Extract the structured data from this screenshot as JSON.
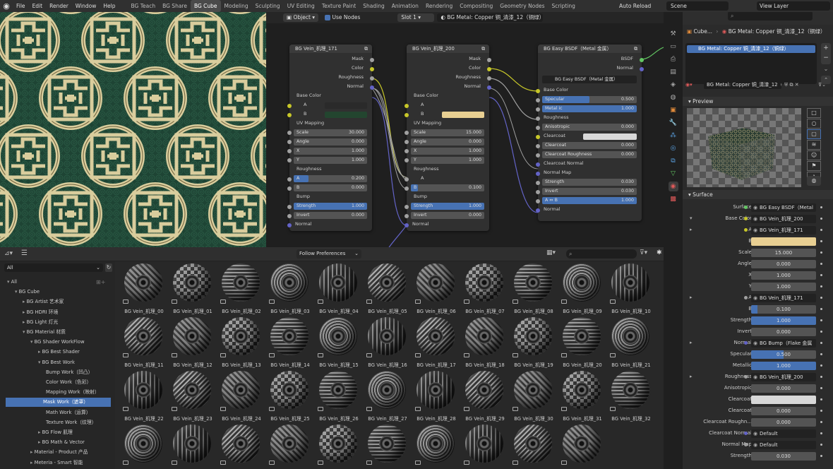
{
  "menu": [
    "File",
    "Edit",
    "Render",
    "Window",
    "Help"
  ],
  "workspaces": [
    "BG Teach",
    "BG Share",
    "BG Cube",
    "Modeling",
    "Sculpting",
    "UV Editing",
    "Texture Paint",
    "Shading",
    "Animation",
    "Rendering",
    "Compositing",
    "Geometry Nodes",
    "Scripting"
  ],
  "active_workspace": "BG Cube",
  "auto_reload": "Auto Reload",
  "scene": "Scene",
  "view_layer": "View Layer",
  "node_header": {
    "object": "Object",
    "use_nodes": "Use Nodes",
    "slot": "Slot 1",
    "material": "BG Metal: Copper 铜_清漆_12（铜绿）"
  },
  "nodes": {
    "vein171": {
      "title": "BG Vein_机理_171",
      "outputs": [
        "Mask",
        "Color",
        "Roughness",
        "Normal"
      ],
      "base_color": "Base Color",
      "a": "A",
      "b": "B",
      "uv_mapping": "UV Mapping",
      "scale_l": "Scale",
      "scale": "30.000",
      "angle_l": "Angle",
      "angle": "0.000",
      "x_l": "X",
      "x": "1.000",
      "y_l": "Y",
      "y": "1.000",
      "roughness": "Roughness",
      "ra": "0.200",
      "rb": "0.000",
      "bump": "Bump",
      "strength_l": "Strength",
      "strength": "1.000",
      "invert_l": "Invert",
      "invert": "0.000",
      "normal": "Normal"
    },
    "vein200": {
      "title": "BG Vein_机理_200",
      "outputs": [
        "Mask",
        "Color",
        "Roughness",
        "Normal"
      ],
      "base_color": "Base Color",
      "a": "A",
      "b": "B",
      "uv_mapping": "UV Mapping",
      "scale_l": "Scale",
      "scale": "15.000",
      "angle_l": "Angle",
      "angle": "0.000",
      "x_l": "X",
      "x": "1.000",
      "y_l": "Y",
      "y": "1.000",
      "roughness": "Roughness",
      "ra": "A",
      "rb": "0.100",
      "bump": "Bump",
      "strength_l": "Strength",
      "strength": "1.000",
      "invert_l": "Invert",
      "invert": "0.000",
      "normal": "Normal"
    },
    "bsdf": {
      "title": "BG Easy BSDF（Metal 金属）",
      "outputs": [
        "BSDF",
        "Normal"
      ],
      "group": "BG Easy BSDF（Metal 金属）",
      "base_color": "Base Color",
      "specular_l": "Specular",
      "specular": "0.500",
      "metal_l": "Metal ic",
      "metal": "1.000",
      "roughness": "Roughness",
      "aniso_l": "Anisotropic",
      "aniso": "0.000",
      "clearcoat": "Clearcoat",
      "cc_l": "Clearcoat",
      "cc": "0.000",
      "ccr_l": "Clearcoat Roughness",
      "ccr": "0.000",
      "ccn": "Clearcoat Normal",
      "nmap": "Normal Map",
      "strength_l": "Strength",
      "strength": "0.030",
      "invert_l": "Invert",
      "invert": "0.030",
      "ab_l": "A ⇔ B",
      "ab": "1.000",
      "normal": "Normal"
    }
  },
  "browser": {
    "filter": "Follow Preferences",
    "library": "All",
    "tree": [
      {
        "label": "All",
        "depth": 0,
        "arrow": "▾"
      },
      {
        "label": "BG Cube",
        "depth": 1,
        "arrow": "▾"
      },
      {
        "label": "BG Artist 艺术家",
        "depth": 2,
        "arrow": "▸"
      },
      {
        "label": "BG HDRI 环境",
        "depth": 2,
        "arrow": "▸"
      },
      {
        "label": "BG Light 灯光",
        "depth": 2,
        "arrow": "▸"
      },
      {
        "label": "BG Material 材质",
        "depth": 2,
        "arrow": "▾"
      },
      {
        "label": "BG Shader WorkFlow",
        "depth": 3,
        "arrow": "▾"
      },
      {
        "label": "BG Best Shader",
        "depth": 4,
        "arrow": "▸"
      },
      {
        "label": "BG Best Work",
        "depth": 4,
        "arrow": "▾"
      },
      {
        "label": "Bump Work（凹凸）",
        "depth": 5,
        "arrow": ""
      },
      {
        "label": "Color Work（色彩）",
        "depth": 5,
        "arrow": ""
      },
      {
        "label": "Mapping Work（映射）",
        "depth": 5,
        "arrow": ""
      },
      {
        "label": "Mask Work（遮罩）",
        "depth": 5,
        "arrow": "",
        "selected": true
      },
      {
        "label": "Math Work（运算）",
        "depth": 5,
        "arrow": ""
      },
      {
        "label": "Texture Work（纹理）",
        "depth": 5,
        "arrow": ""
      },
      {
        "label": "BG Flow 肌理",
        "depth": 4,
        "arrow": "▸"
      },
      {
        "label": "BG Math & Vector",
        "depth": 4,
        "arrow": "▸"
      },
      {
        "label": "Material - Product 产品",
        "depth": 3,
        "arrow": "▸"
      },
      {
        "label": "Meteria - Smart 智能",
        "depth": 3,
        "arrow": "▸"
      }
    ],
    "assets": [
      "BG Vein_机理_00",
      "BG Vein_机理_01",
      "BG Vein_机理_02",
      "BG Vein_机理_03",
      "BG Vein_机理_04",
      "BG Vein_机理_05",
      "BG Vein_机理_06",
      "BG Vein_机理_07",
      "BG Vein_机理_08",
      "BG Vein_机理_09",
      "BG Vein_机理_10",
      "BG Vein_机理_11",
      "BG Vein_机理_12",
      "BG Vein_机理_13",
      "BG Vein_机理_14",
      "BG Vein_机理_15",
      "BG Vein_机理_16",
      "BG Vein_机理_17",
      "BG Vein_机理_18",
      "BG Vein_机理_19",
      "BG Vein_机理_20",
      "BG Vein_机理_21",
      "BG Vein_机理_22",
      "BG Vein_机理_23",
      "BG Vein_机理_24",
      "BG Vein_机理_25",
      "BG Vein_机理_26",
      "BG Vein_机理_27",
      "BG Vein_机理_28",
      "BG Vein_机理_29",
      "BG Vein_机理_30",
      "BG Vein_机理_31",
      "BG Vein_机理_32",
      "",
      "",
      "",
      "",
      "",
      "",
      "",
      "",
      "",
      ""
    ]
  },
  "props": {
    "breadcrumb": [
      "Cube...",
      "BG Metal: Copper 铜_清漆_12（铜绿）"
    ],
    "slot_item": "BG Metal: Copper 铜_清漆_12（铜绿）",
    "material_name": "BG Metal: Copper 铜_清漆_12（...",
    "preview": "Preview",
    "surface": "Surface",
    "rows": [
      {
        "label": "Surface",
        "value": "BG Easy BSDF（Metal 金...",
        "kind": "link",
        "sock": "#63c763"
      },
      {
        "label": "Base Color",
        "value": "BG Vein_机理_200",
        "kind": "link",
        "sock": "#c7c729",
        "arrow": "▾"
      },
      {
        "label": "A",
        "value": "BG Vein_机理_171",
        "kind": "link",
        "sock": "#c7c729",
        "arrow": "▸"
      },
      {
        "label": "B",
        "value": "",
        "kind": "color",
        "color": "#e8cf92"
      },
      {
        "label": "Scale",
        "value": "15.000",
        "kind": "num"
      },
      {
        "label": "Angle",
        "value": "0.000",
        "kind": "num"
      },
      {
        "label": "X",
        "value": "1.000",
        "kind": "num"
      },
      {
        "label": "Y",
        "value": "1.000",
        "kind": "num"
      },
      {
        "label": "A",
        "value": "BG Vein_机理_171",
        "kind": "link",
        "sock": "#a1a1a1",
        "arrow": "▸"
      },
      {
        "label": "B",
        "value": "0.100",
        "kind": "bar",
        "fill": 0.1
      },
      {
        "label": "Strength",
        "value": "1.000",
        "kind": "bar",
        "fill": 1
      },
      {
        "label": "Invert",
        "value": "0.000",
        "kind": "num"
      },
      {
        "label": "Normal",
        "value": "BG Bump（Flake 金属亮片...",
        "kind": "link",
        "sock": "#6363c7",
        "arrow": "▸"
      },
      {
        "label": "Specular",
        "value": "0.500",
        "kind": "bar",
        "fill": 0.5
      },
      {
        "label": "Metallic",
        "value": "1.000",
        "kind": "bar",
        "fill": 1
      },
      {
        "label": "Roughness",
        "value": "BG Vein_机理_200",
        "kind": "link",
        "sock": "#a1a1a1",
        "arrow": "▸"
      },
      {
        "label": "Anisotropic",
        "value": "0.000",
        "kind": "num"
      },
      {
        "label": "Clearcoat",
        "value": "",
        "kind": "color",
        "color": "#d8d8d8"
      },
      {
        "label": "Clearcoat",
        "value": "0.000",
        "kind": "num"
      },
      {
        "label": "Clearcoat Roughn...",
        "value": "0.000",
        "kind": "num"
      },
      {
        "label": "Clearcoat Normal",
        "value": "Default",
        "kind": "link",
        "sock": "#6363c7"
      },
      {
        "label": "Normal Map",
        "value": "Default",
        "kind": "link",
        "sock": "#a1a1a1"
      },
      {
        "label": "Strength",
        "value": "0.030",
        "kind": "num"
      }
    ]
  }
}
